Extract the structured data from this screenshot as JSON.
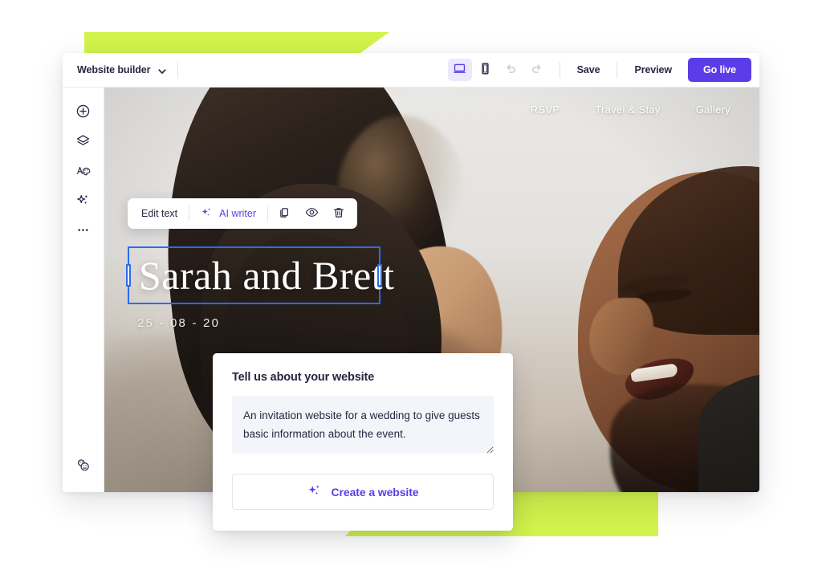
{
  "colors": {
    "accent_purple": "#5b3de8",
    "accent_purple_soft": "#ece9fd",
    "lime": "#d2f34c",
    "selection_blue": "#2b6bf0",
    "text_dark": "#282541",
    "textarea_bg": "#f4f5fa"
  },
  "topbar": {
    "project_title": "Website builder",
    "chevron_icon": "chevron-down-icon",
    "desktop_view_icon": "desktop-monitor-icon",
    "mobile_view_icon": "mobile-phone-icon",
    "undo_icon": "undo-arrow-icon",
    "redo_icon": "redo-arrow-icon",
    "save_label": "Save",
    "preview_label": "Preview",
    "golive_label": "Go live",
    "active_view": "desktop"
  },
  "sidebar": {
    "items": [
      {
        "icon": "plus-circle-icon",
        "name": "add-element"
      },
      {
        "icon": "layers-icon",
        "name": "pages-layers"
      },
      {
        "icon": "palette-icon",
        "name": "theme-design"
      },
      {
        "icon": "sparkle-icon",
        "name": "ai-tools"
      },
      {
        "icon": "ellipsis-icon",
        "name": "more-options"
      }
    ],
    "bottom_item": {
      "icon": "collaborators-icon",
      "name": "collaborators"
    }
  },
  "site": {
    "nav_links": [
      "RSVP",
      "Travel & Stay",
      "Gallery"
    ],
    "headline": "Sarah and Brett",
    "date": "25 - 08 - 20"
  },
  "element_toolbar": {
    "edit_text_label": "Edit text",
    "ai_writer_label": "AI writer",
    "ai_writer_icon": "sparkle-icon",
    "duplicate_icon": "duplicate-icon",
    "hide_icon": "eye-icon",
    "delete_icon": "trash-icon"
  },
  "ai_card": {
    "title": "Tell us about your website",
    "prompt_value": "An invitation website for a wedding to give guests basic information about the event.",
    "prompt_placeholder": "Tell us about your website",
    "create_button_label": "Create a website",
    "create_button_icon": "sparkle-icon",
    "resize_handle": "textarea-resize-handle"
  }
}
